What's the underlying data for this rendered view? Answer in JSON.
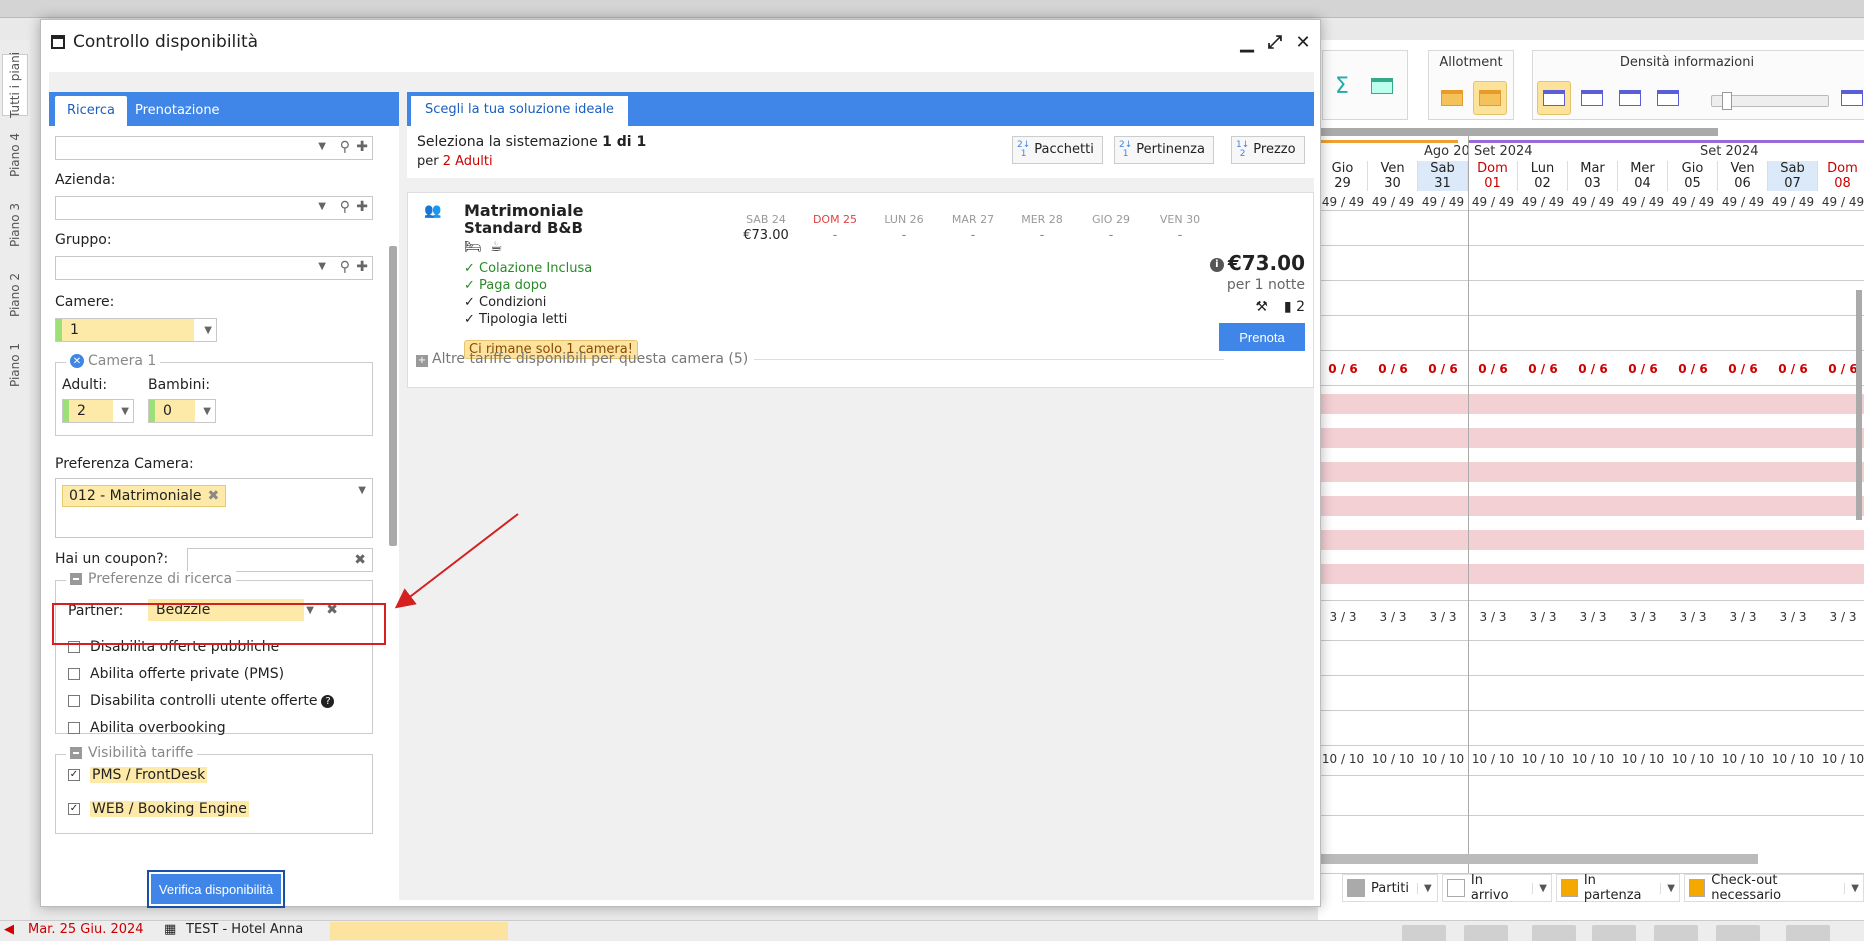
{
  "dialog": {
    "title": "Controllo disponibilità",
    "left_tabs": [
      "Ricerca",
      "Prenotazione"
    ],
    "right_tab": "Scegli la tua soluzione ideale"
  },
  "form": {
    "azienda_label": "Azienda:",
    "gruppo_label": "Gruppo:",
    "camere_label": "Camere:",
    "camere_value": "1",
    "camera_group": "Camera 1",
    "adulti_label": "Adulti:",
    "adulti_value": "2",
    "bambini_label": "Bambini:",
    "bambini_value": "0",
    "pref_label": "Preferenza Camera:",
    "pref_tag": "012 - Matrimoniale",
    "coupon_label": "Hai un coupon?:",
    "pref_ricerca": "Preferenze di ricerca",
    "partner_label": "Partner:",
    "partner_value": "Bedzzle",
    "checks": [
      "Disabilita offerte pubbliche",
      "Abilita offerte private (PMS)",
      "Disabilita controlli utente offerte",
      "Abilita overbooking"
    ],
    "visibilita": "Visibilità tariffe",
    "vis_checks": [
      "PMS / FrontDesk",
      "WEB / Booking Engine"
    ],
    "verify_button": "Verifica disponibilità"
  },
  "results": {
    "select_prefix": "Seleziona la sistemazione ",
    "select_count": "1 di 1",
    "for_prefix": "per ",
    "for_value": "2 Adulti",
    "sort_buttons": [
      "Pacchetti",
      "Pertinenza",
      "Prezzo"
    ],
    "room_name": "Matrimoniale",
    "rate_name": "Standard B&B",
    "perks": [
      "✓ Colazione Inclusa",
      "✓ Paga dopo",
      "✓ Condizioni",
      "✓ Tipologia letti"
    ],
    "availability_note": "Ci rimane solo 1 camera!",
    "days": [
      {
        "d": "SAB 24",
        "p": "€73.00"
      },
      {
        "d": "DOM 25",
        "p": "-"
      },
      {
        "d": "LUN 26",
        "p": "-"
      },
      {
        "d": "MAR 27",
        "p": "-"
      },
      {
        "d": "MER 28",
        "p": "-"
      },
      {
        "d": "GIO 29",
        "p": "-"
      },
      {
        "d": "VEN 30",
        "p": "-"
      }
    ],
    "price": "€73.00",
    "per_nights": "per 1 notte",
    "rooms_left": "2",
    "book_button": "Prenota",
    "more_rates": "Altre tariffe disponibili per questa camera (5)"
  },
  "background": {
    "rail_tabs": [
      "Tutti i piani",
      "Piano 4",
      "Piano 3",
      "Piano 2",
      "Piano 1"
    ],
    "toolbar_groups": [
      "Allotment",
      "Densità informazioni"
    ],
    "months": [
      "Ago 20",
      "Set 2024",
      "Set 2024"
    ],
    "days": [
      {
        "w": "Gio",
        "n": "29"
      },
      {
        "w": "Ven",
        "n": "30"
      },
      {
        "w": "Sab",
        "n": "31"
      },
      {
        "w": "Dom",
        "n": "01"
      },
      {
        "w": "Lun",
        "n": "02"
      },
      {
        "w": "Mar",
        "n": "03"
      },
      {
        "w": "Mer",
        "n": "04"
      },
      {
        "w": "Gio",
        "n": "05"
      },
      {
        "w": "Ven",
        "n": "06"
      },
      {
        "w": "Sab",
        "n": "07"
      },
      {
        "w": "Dom",
        "n": "08"
      }
    ],
    "row_total": "49 / 49",
    "row_zero": "0 / 6",
    "row_three": "3 / 3",
    "row_ten": "10 / 10",
    "legend": [
      "Partiti",
      "In arrivo",
      "In partenza",
      "Check-out necessario"
    ],
    "legend_colors": [
      "#aaaaaa",
      "#ffffff",
      "#f5a800",
      "#f5a800"
    ]
  },
  "status": {
    "date": "Mar. 25 Giu. 2024",
    "hotel": "TEST - Hotel Anna"
  }
}
